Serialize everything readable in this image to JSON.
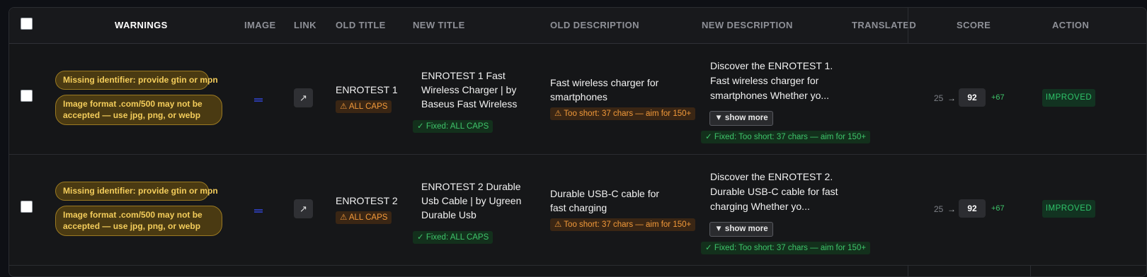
{
  "header": {
    "warnings": "WARNINGS",
    "image": "IMAGE",
    "link": "LINK",
    "old_title": "OLD TITLE",
    "new_title": "NEW TITLE",
    "old_description": "OLD DESCRIPTION",
    "new_description": "NEW DESCRIPTION",
    "translated": "TRANSLATED",
    "score": "SCORE",
    "action": "ACTION"
  },
  "icons": {
    "link": "external-link-arrow-icon",
    "warning": "warning-triangle-icon",
    "check": "check-icon",
    "show_more": "caret-down-icon",
    "image": "broken-image-icon"
  },
  "colors": {
    "warning_pill_bg": "#4a3a12",
    "warning_pill_text": "#f4cd5b",
    "orange_tag": "#f39a3a",
    "green_tag": "#3ec46a",
    "status_green": "#2fc46a"
  },
  "rows": [
    {
      "warnings": [
        "Missing identifier: provide gtin or mpn",
        "Image format .com/500 may not be accepted — use jpg, png, or webp"
      ],
      "link_glyph": "↗",
      "old_title": "ENROTEST 1",
      "old_title_flag": "⚠ ALL CAPS",
      "new_title": "ENROTEST 1 Fast Wireless Charger | by Baseus Fast Wireless",
      "new_title_fix": "✓ Fixed: ALL CAPS",
      "old_description": "Fast wireless charger for smartphones",
      "old_description_flag": "⚠ Too short: 37 chars — aim for 150+",
      "new_description": "Discover the ENROTEST 1. Fast wireless charger for smartphones Whether yo...",
      "show_more": "▼ show more",
      "new_description_fix": "✓ Fixed: Too short: 37 chars — aim for 150+",
      "translated": "",
      "score_old": "25",
      "arrow": "→",
      "score_new": "92",
      "score_delta": "+67",
      "status": "IMPROVED"
    },
    {
      "warnings": [
        "Missing identifier: provide gtin or mpn",
        "Image format .com/500 may not be accepted — use jpg, png, or webp"
      ],
      "link_glyph": "↗",
      "old_title": "ENROTEST 2",
      "old_title_flag": "⚠ ALL CAPS",
      "new_title": "ENROTEST 2 Durable Usb Cable | by Ugreen Durable Usb",
      "new_title_fix": "✓ Fixed: ALL CAPS",
      "old_description": "Durable USB-C cable for fast charging",
      "old_description_flag": "⚠ Too short: 37 chars — aim for 150+",
      "new_description": "Discover the ENROTEST 2. Durable USB-C cable for fast charging Whether yo...",
      "show_more": "▼ show more",
      "new_description_fix": "✓ Fixed: Too short: 37 chars — aim for 150+",
      "translated": "",
      "score_old": "25",
      "arrow": "→",
      "score_new": "92",
      "score_delta": "+67",
      "status": "IMPROVED"
    }
  ]
}
